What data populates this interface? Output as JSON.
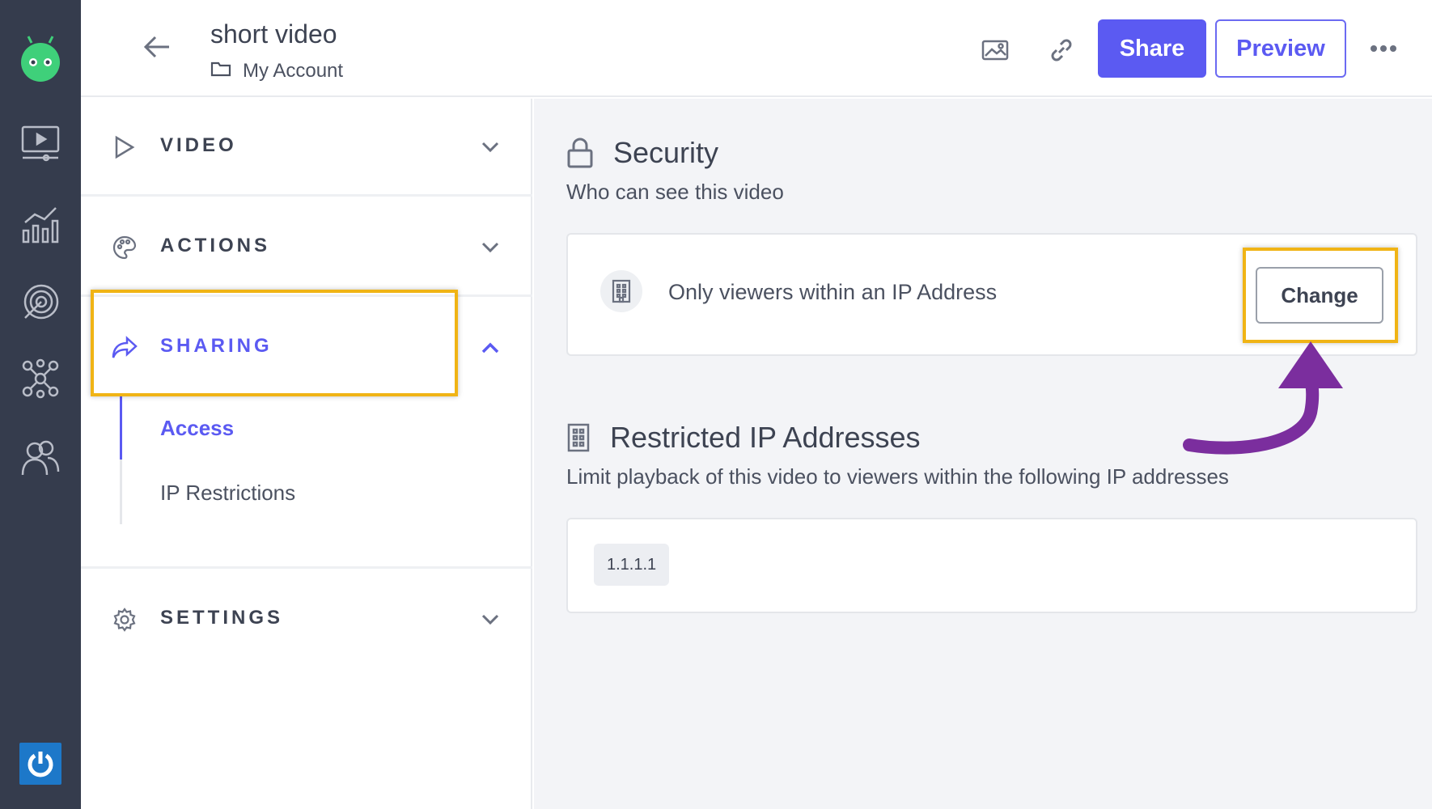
{
  "header": {
    "title": "short video",
    "folder": "My Account",
    "share_label": "Share",
    "preview_label": "Preview"
  },
  "sidebar": {
    "sections": [
      {
        "label": "VIDEO",
        "icon": "play-icon",
        "expanded": false
      },
      {
        "label": "ACTIONS",
        "icon": "palette-icon",
        "expanded": false
      },
      {
        "label": "SHARING",
        "icon": "share-icon",
        "expanded": true
      },
      {
        "label": "SETTINGS",
        "icon": "gear-icon",
        "expanded": false
      }
    ],
    "sharing_items": [
      {
        "label": "Access",
        "active": true
      },
      {
        "label": "IP Restrictions",
        "active": false
      }
    ]
  },
  "main": {
    "security": {
      "title": "Security",
      "subtitle": "Who can see this video",
      "setting_text": "Only viewers within an IP Address",
      "change_label": "Change"
    },
    "restricted": {
      "title": "Restricted IP Addresses",
      "subtitle": "Limit playback of this video to viewers within the following IP addresses",
      "ips": [
        "1.1.1.1"
      ]
    }
  },
  "colors": {
    "rail": "#353c4d",
    "accent": "#5b5af2",
    "highlight": "#f0b415",
    "annotation_arrow": "#7b2e9e"
  }
}
